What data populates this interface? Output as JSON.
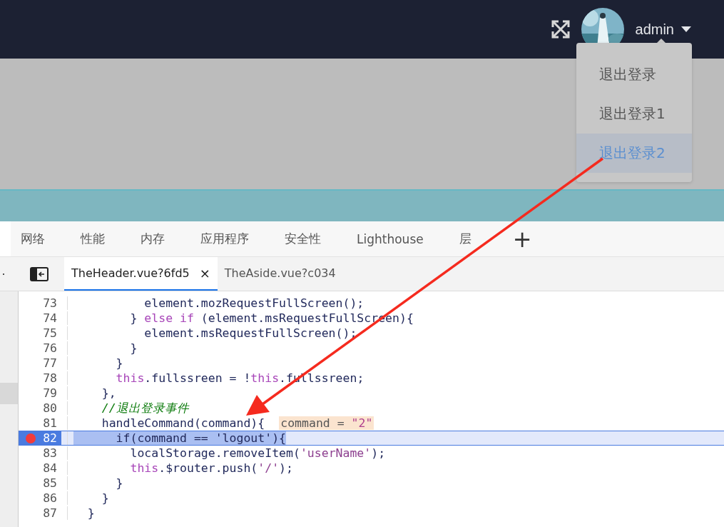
{
  "header": {
    "username": "admin",
    "menu": [
      {
        "label": "退出登录",
        "selected": false
      },
      {
        "label": "退出登录1",
        "selected": false
      },
      {
        "label": "退出登录2",
        "selected": true
      }
    ]
  },
  "devtools": {
    "panel_tabs": [
      {
        "label": "网络",
        "selected": false
      },
      {
        "label": "性能",
        "selected": false
      },
      {
        "label": "内存",
        "selected": false
      },
      {
        "label": "应用程序",
        "selected": false
      },
      {
        "label": "安全性",
        "selected": false
      },
      {
        "label": "Lighthouse",
        "selected": false
      },
      {
        "label": "层",
        "selected": false
      }
    ],
    "add_tab": "+",
    "more": "·",
    "file_tabs": [
      {
        "label": "TheHeader.vue?6fd5",
        "selected": true,
        "close": "×"
      },
      {
        "label": "TheAside.vue?c034",
        "selected": false
      }
    ],
    "code": [
      {
        "number": "73",
        "breakpoint": false,
        "paused": false,
        "segments": [
          {
            "kind": "plain",
            "text": "          element.mozRequestFullScreen();"
          }
        ]
      },
      {
        "number": "74",
        "breakpoint": false,
        "paused": false,
        "segments": [
          {
            "kind": "plain",
            "text": "        } "
          },
          {
            "kind": "keyword",
            "text": "else if"
          },
          {
            "kind": "plain",
            "text": " (element.msRequestFullScreen){"
          }
        ]
      },
      {
        "number": "75",
        "breakpoint": false,
        "paused": false,
        "segments": [
          {
            "kind": "plain",
            "text": "          element.msRequestFullScreen();"
          }
        ]
      },
      {
        "number": "76",
        "breakpoint": false,
        "paused": false,
        "segments": [
          {
            "kind": "plain",
            "text": "        }"
          }
        ]
      },
      {
        "number": "77",
        "breakpoint": false,
        "paused": false,
        "segments": [
          {
            "kind": "plain",
            "text": "      }"
          }
        ]
      },
      {
        "number": "78",
        "breakpoint": false,
        "paused": false,
        "segments": [
          {
            "kind": "keyword",
            "text": "      this"
          },
          {
            "kind": "plain",
            "text": ".fullssreen = !"
          },
          {
            "kind": "keyword",
            "text": "this"
          },
          {
            "kind": "plain",
            "text": ".fullssreen;"
          }
        ]
      },
      {
        "number": "79",
        "breakpoint": false,
        "paused": false,
        "segments": [
          {
            "kind": "plain",
            "text": "    },"
          }
        ]
      },
      {
        "number": "80",
        "breakpoint": false,
        "paused": false,
        "segments": [
          {
            "kind": "comment",
            "text": "    //退出登录事件"
          }
        ]
      },
      {
        "number": "81",
        "breakpoint": false,
        "paused": false,
        "segments": [
          {
            "kind": "plain",
            "text": "    handleCommand(command){"
          }
        ],
        "inline_value": {
          "name": "command = ",
          "value": "\"2\""
        }
      },
      {
        "number": "82",
        "breakpoint": true,
        "paused": true,
        "segments": [
          {
            "kind": "plain",
            "text": "      if(command == 'logout'){"
          }
        ]
      },
      {
        "number": "83",
        "breakpoint": false,
        "paused": false,
        "segments": [
          {
            "kind": "plain",
            "text": "        localStorage.removeItem("
          },
          {
            "kind": "string",
            "text": "'userName'"
          },
          {
            "kind": "plain",
            "text": ");"
          }
        ]
      },
      {
        "number": "84",
        "breakpoint": false,
        "paused": false,
        "segments": [
          {
            "kind": "keyword",
            "text": "        this"
          },
          {
            "kind": "plain",
            "text": ".$router.push("
          },
          {
            "kind": "string",
            "text": "'/'"
          },
          {
            "kind": "plain",
            "text": ");"
          }
        ]
      },
      {
        "number": "85",
        "breakpoint": false,
        "paused": false,
        "segments": [
          {
            "kind": "plain",
            "text": "      }"
          }
        ]
      },
      {
        "number": "86",
        "breakpoint": false,
        "paused": false,
        "segments": [
          {
            "kind": "plain",
            "text": "    }"
          }
        ]
      },
      {
        "number": "87",
        "breakpoint": false,
        "paused": false,
        "segments": [
          {
            "kind": "plain",
            "text": "  }"
          }
        ]
      }
    ]
  }
}
